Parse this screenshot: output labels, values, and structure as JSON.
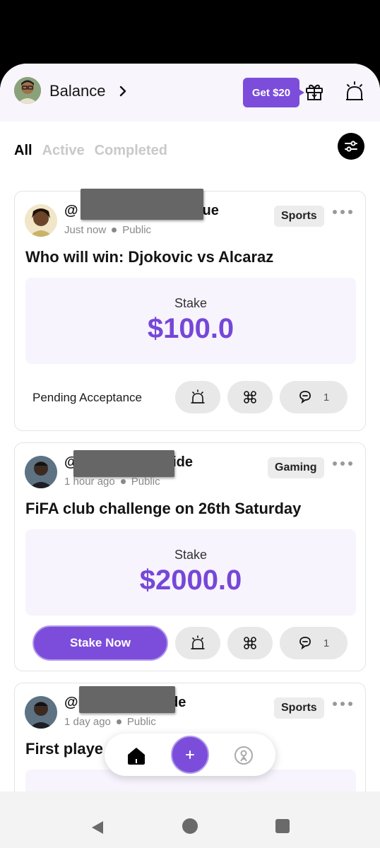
{
  "header": {
    "balance_label": "Balance",
    "promo_label": "Get $20"
  },
  "tabs": [
    {
      "label": "All",
      "active": true
    },
    {
      "label": "Active",
      "active": false
    },
    {
      "label": "Completed",
      "active": false
    }
  ],
  "posts": [
    {
      "handle_start": "@",
      "handle_end": "ue",
      "time": "Just now",
      "visibility": "Public",
      "category": "Sports",
      "title": "Who will win: Djokovic vs Alcaraz",
      "stake_label": "Stake",
      "stake_amount": "$100.0",
      "status": "Pending Acceptance",
      "comment_count": "1"
    },
    {
      "handle_start": "@",
      "handle_end": "jide",
      "time": "1 hour ago",
      "visibility": "Public",
      "category": "Gaming",
      "title": "FiFA club challenge on 26th Saturday",
      "stake_label": "Stake",
      "stake_amount": "$2000.0",
      "action_label": "Stake Now",
      "comment_count": "1"
    },
    {
      "handle_start": "@l",
      "handle_end": "de",
      "time": "1 day ago",
      "visibility": "Public",
      "category": "Sports",
      "title": "First playe"
    }
  ],
  "colors": {
    "accent": "#7c4ddb",
    "stake_text": "#7647d8",
    "stake_bg": "#f7f4fd"
  },
  "icons": [
    "chevron-right-icon",
    "gift-icon",
    "bell-icon",
    "filter-icon",
    "more-icon",
    "alarm-icon",
    "network-icon",
    "chat-icon",
    "home-icon",
    "plus-icon",
    "profile-icon"
  ]
}
